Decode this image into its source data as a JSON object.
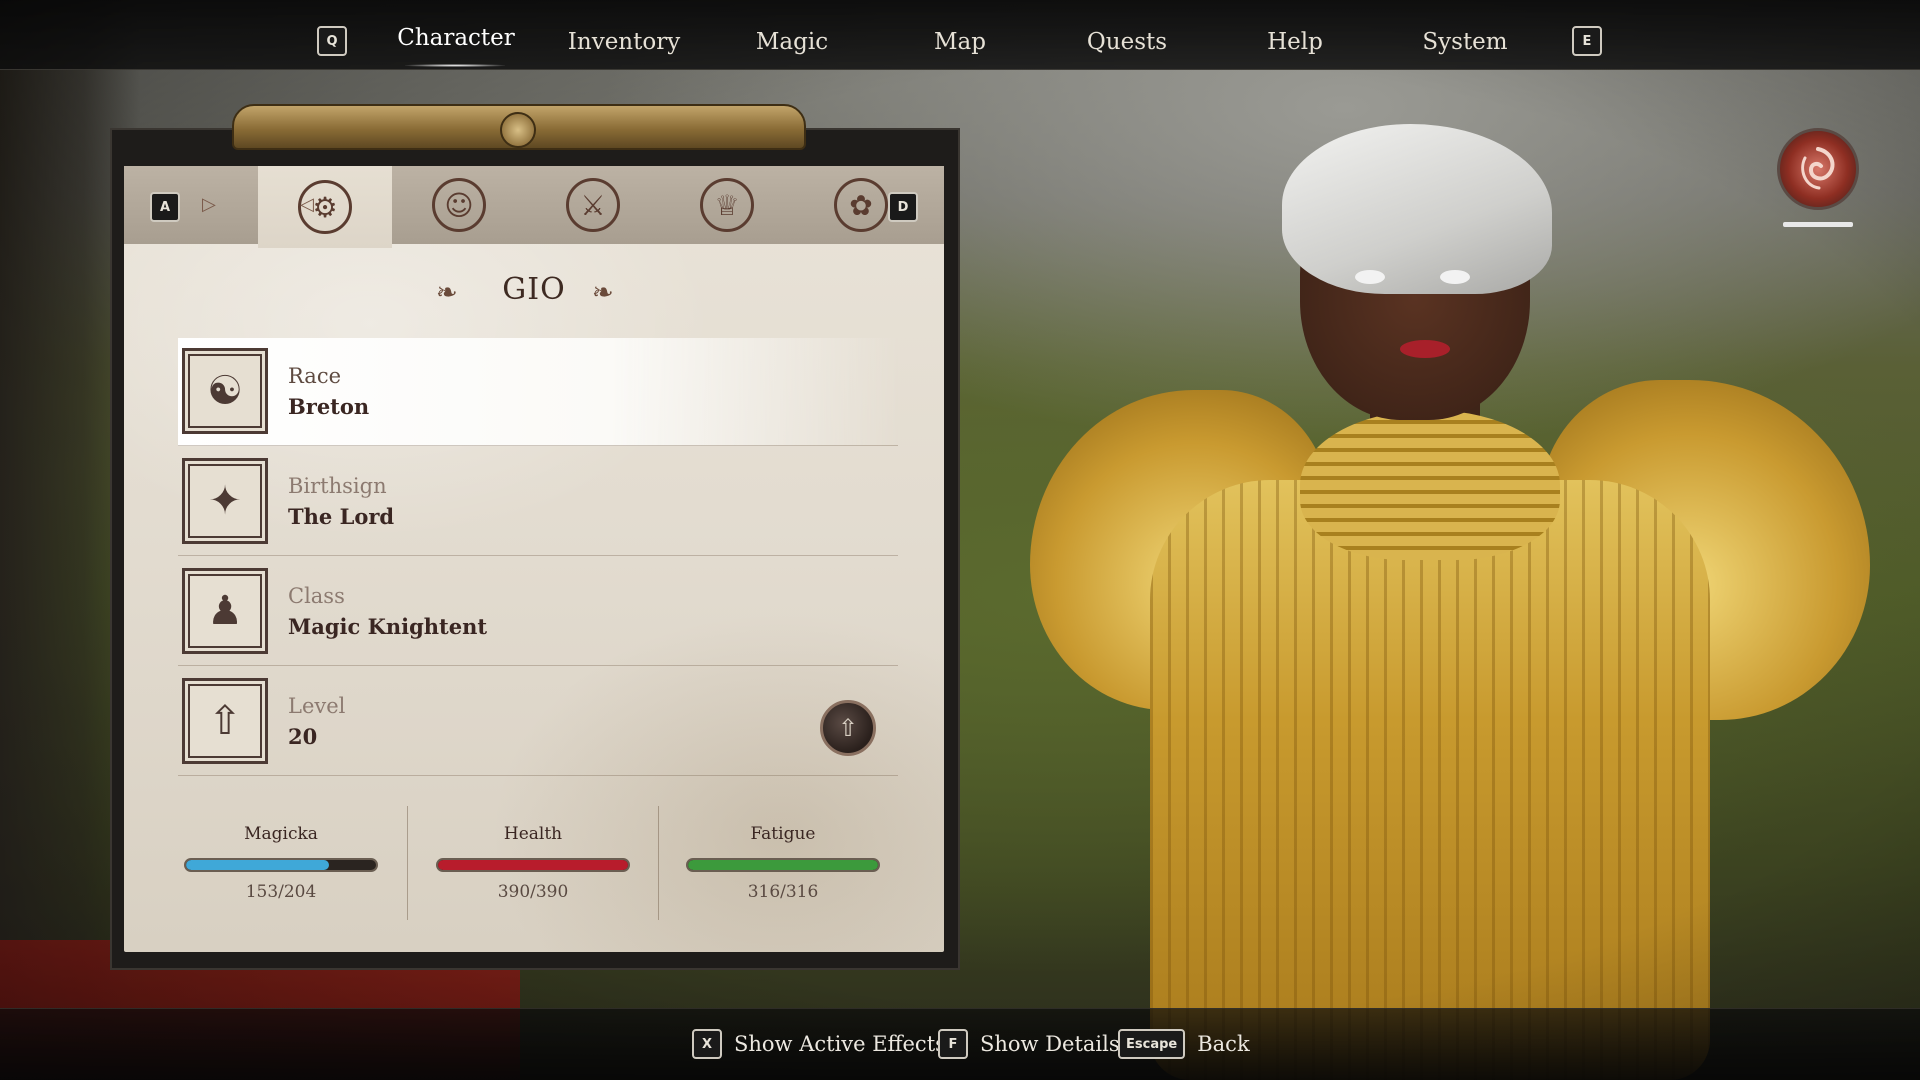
{
  "nav": {
    "prev_key": "Q",
    "next_key": "E",
    "tabs": [
      {
        "label": "Character",
        "active": true
      },
      {
        "label": "Inventory",
        "active": false
      },
      {
        "label": "Magic",
        "active": false
      },
      {
        "label": "Map",
        "active": false
      },
      {
        "label": "Quests",
        "active": false
      },
      {
        "label": "Help",
        "active": false
      },
      {
        "label": "System",
        "active": false
      }
    ]
  },
  "subtabs": {
    "prev_key": "A",
    "next_key": "D",
    "items": [
      {
        "icon": "character-crest-icon",
        "active": true
      },
      {
        "icon": "attributes-figure-icon",
        "active": false
      },
      {
        "icon": "skills-torch-icon",
        "active": false
      },
      {
        "icon": "factions-crown-icon",
        "active": false
      },
      {
        "icon": "misc-flowers-icon",
        "active": false
      }
    ]
  },
  "character": {
    "name": "GIO",
    "rows": [
      {
        "label": "Race",
        "value": "Breton",
        "icon": "two-faces-icon",
        "selected": true
      },
      {
        "label": "Birthsign",
        "value": "The Lord",
        "icon": "constellation-icon",
        "selected": false
      },
      {
        "label": "Class",
        "value": "Magic Knightent",
        "icon": "hooded-figure-icon",
        "selected": false
      },
      {
        "label": "Level",
        "value": "20",
        "icon": "level-arrow-icon",
        "selected": false
      }
    ]
  },
  "stats": [
    {
      "label": "Magicka",
      "value": "153/204",
      "fraction": 0.75,
      "color": "#3fa8d8"
    },
    {
      "label": "Health",
      "value": "390/390",
      "fraction": 1.0,
      "color": "#b81c2c"
    },
    {
      "label": "Fatigue",
      "value": "316/316",
      "fraction": 1.0,
      "color": "#3c9a3c"
    }
  ],
  "hints": [
    {
      "key": "X",
      "label": "Show Active Effects"
    },
    {
      "key": "F",
      "label": "Show Details"
    },
    {
      "key": "Escape",
      "label": "Back"
    }
  ],
  "colors": {
    "parchment": "#e6dfd2",
    "ink": "#3a2622",
    "armor_gold": "#d4aa3c"
  }
}
